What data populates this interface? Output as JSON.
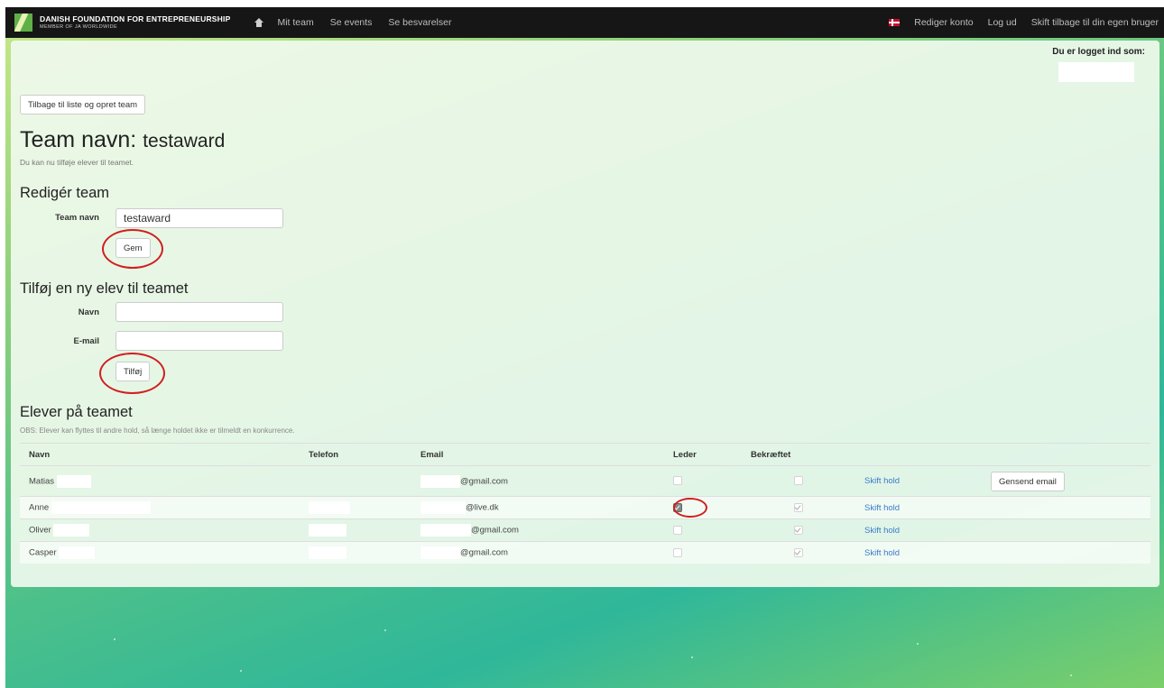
{
  "nav": {
    "brand_title": "DANISH FOUNDATION FOR ENTREPRENEURSHIP",
    "brand_subtitle": "MEMBER OF JA WORLDWIDE",
    "links": [
      "Mit team",
      "Se events",
      "Se besvarelser"
    ],
    "right_links": [
      "Rediger konto",
      "Log ud",
      "Skift tilbage til din egen bruger"
    ]
  },
  "logged_in_label": "Du er logget ind som:",
  "back_button": "Tilbage til liste og opret team",
  "title_prefix": "Team navn:",
  "team_name": "testaward",
  "hint": "Du kan nu tilføje elever til teamet.",
  "edit_section": {
    "heading": "Redigér team",
    "name_label": "Team navn",
    "name_value": "testaward",
    "save_button": "Gem"
  },
  "add_section": {
    "heading": "Tilføj en ny elev til teamet",
    "name_label": "Navn",
    "email_label": "E-mail",
    "add_button": "Tilføj"
  },
  "students_section": {
    "heading": "Elever på teamet",
    "note": "OBS: Elever kan flyttes til andre hold, så længe holdet ikke er tilmeldt en konkurrence.",
    "columns": [
      "Navn",
      "Telefon",
      "Email",
      "Leder",
      "Bekræftet"
    ],
    "rows": [
      {
        "name": "Matias",
        "email": "@gmail.com",
        "leader": false,
        "confirmed": false,
        "action": "Skift hold",
        "resend": "Gensend email"
      },
      {
        "name": "Anne",
        "email": "@live.dk",
        "leader": true,
        "confirmed": true,
        "action": "Skift hold"
      },
      {
        "name": "Oliver",
        "email": "@gmail.com",
        "leader": false,
        "confirmed": true,
        "action": "Skift hold"
      },
      {
        "name": "Casper",
        "email": "@gmail.com",
        "leader": false,
        "confirmed": true,
        "action": "Skift hold"
      }
    ]
  },
  "colors": {
    "navbar": "#161616",
    "link": "#3a7bc8",
    "annotation_circle": "#d01f1f"
  }
}
